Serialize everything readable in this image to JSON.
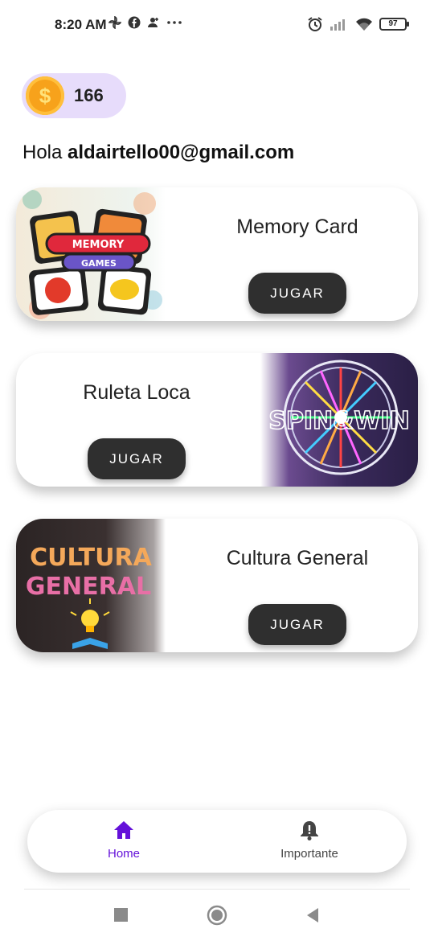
{
  "status_bar": {
    "time": "8:20 AM",
    "battery": "97",
    "left_icons": [
      "pinwheel-icon",
      "facebook-icon",
      "contact-icon",
      "more-icon"
    ],
    "right_icons": [
      "alarm-icon",
      "signal-icon",
      "wifi-icon",
      "battery-icon"
    ]
  },
  "coins": {
    "symbol": "$",
    "count": "166"
  },
  "greeting": {
    "prefix": "Hola",
    "email": "aldairtello00@gmail.com"
  },
  "games": [
    {
      "title": "Memory Card",
      "button": "JUGAR",
      "image_label_1": "MEMORY",
      "image_label_2": "GAMES"
    },
    {
      "title": "Ruleta Loca",
      "button": "JUGAR",
      "image_label": "SPIN&WIN"
    },
    {
      "title": "Cultura General",
      "button": "JUGAR",
      "image_label_1": "CULTURA",
      "image_label_2": "GENERAL"
    }
  ],
  "bottom_nav": {
    "items": [
      {
        "label": "Home",
        "icon": "home-icon",
        "active": true,
        "color": "#6411d9"
      },
      {
        "label": "Importante",
        "icon": "bell-alert-icon",
        "active": false,
        "color": "#444444"
      }
    ]
  },
  "system_nav": [
    "recents-icon",
    "home-circle-icon",
    "back-icon"
  ]
}
